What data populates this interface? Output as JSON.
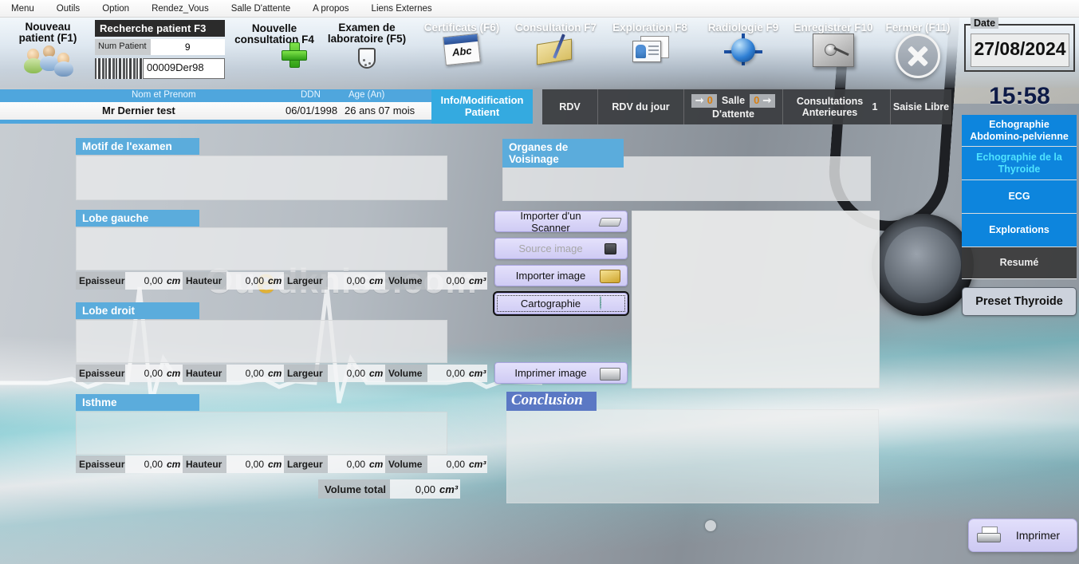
{
  "menubar": {
    "items": [
      {
        "label": "Menu",
        "name": "menu-item-menu"
      },
      {
        "label": "Outils",
        "name": "menu-item-outils"
      },
      {
        "label": "Option",
        "name": "menu-item-option"
      },
      {
        "label": "Rendez_Vous",
        "name": "menu-item-rendez-vous"
      },
      {
        "label": "Salle D'attente",
        "name": "menu-item-salle-dattente"
      },
      {
        "label": "A propos",
        "name": "menu-item-a-propos"
      },
      {
        "label": "Liens Externes",
        "name": "menu-item-liens-externes"
      }
    ]
  },
  "toolbar": {
    "new_patient": "Nouveau patient (F1)",
    "search_title": "Recherche patient F3",
    "num_patient_label": "Num Patient",
    "num_patient_value": "9",
    "barcode_value": "00009Der98",
    "new_consultation": "Nouvelle consultation F4",
    "lab_exam": "Examen de laboratoire (F5)",
    "certificats": "Certificats (F6)",
    "consultation": "Consultation F7",
    "exploration": "Exploration F8",
    "radiologie": "Radiologie F9",
    "enregistrer": "Enregistrer F10",
    "fermer": "Fermer (F11)"
  },
  "date_panel": {
    "legend": "Date",
    "date": "27/08/2024",
    "time": "15:58"
  },
  "patient": {
    "col_name": "Nom et Prenom",
    "col_ddn": "DDN",
    "col_age": "Age (An)",
    "name": "Mr Dernier test",
    "ddn": "06/01/1998",
    "age": "26 ans 07 mois",
    "info_button": "Info/Modification Patient"
  },
  "rdv_strip": {
    "rdv": "RDV",
    "rdv_du_jour": "RDV du jour",
    "waiting_in_count": "0",
    "salle_dattente": "Salle D'attente",
    "waiting_out_count": "0",
    "consultations_anterieures": "Consultations Anterieures",
    "consultations_count": "1",
    "saisie_libre": "Saisie Libre"
  },
  "form": {
    "motif_title": "Motif de l'examen",
    "motif_value": "",
    "lobe_gauche_title": "Lobe gauche",
    "lobe_gauche_value": "",
    "lobe_droit_title": "Lobe droit",
    "lobe_droit_value": "",
    "isthme_title": "Isthme",
    "isthme_value": "",
    "organes_title": "Organes de Voisinage",
    "organes_value": "",
    "conclusion_title": "Conclusion",
    "conclusion_value": "",
    "labels": {
      "epaisseur": "Epaisseur",
      "hauteur": "Hauteur",
      "largeur": "Largeur",
      "volume": "Volume",
      "volume_total": "Volume total",
      "cm": "cm",
      "cm3": "cm³"
    },
    "measurements": {
      "lobe_gauche": {
        "epaisseur": "0,00",
        "hauteur": "0,00",
        "largeur": "0,00",
        "volume": "0,00"
      },
      "lobe_droit": {
        "epaisseur": "0,00",
        "hauteur": "0,00",
        "largeur": "0,00",
        "volume": "0,00"
      },
      "isthme": {
        "epaisseur": "0,00",
        "hauteur": "0,00",
        "largeur": "0,00",
        "volume": "0,00"
      },
      "volume_total": "0,00"
    }
  },
  "image_buttons": {
    "importer_scanner": "Importer d'un Scanner",
    "source_image": "Source image",
    "importer_image": "Importer image",
    "cartographie": "Cartographie",
    "imprimer_image": "Imprimer image"
  },
  "sidebar": {
    "items": [
      {
        "label": "Echographie Abdomino-pelvienne",
        "name": "sidebar-item-echographie-abdomino-pelvienne",
        "state": "normal"
      },
      {
        "label": "Echographie de la Thyroide",
        "name": "sidebar-item-echographie-thyroide",
        "state": "active"
      },
      {
        "label": "ECG",
        "name": "sidebar-item-ecg",
        "state": "normal"
      },
      {
        "label": "Explorations",
        "name": "sidebar-item-explorations",
        "state": "normal"
      },
      {
        "label": "Resumé",
        "name": "sidebar-item-resume",
        "state": "dark"
      }
    ],
    "preset": "Preset Thyroide",
    "print": "Imprimer"
  },
  "watermark": {
    "pre": "Ou",
    "o": "e",
    "post": "dkniss.com",
    "full": "Ouedkniss.com"
  },
  "colors": {
    "accent_blue": "#5bacdc",
    "sidebar_blue": "#0d85dd",
    "sidebar_active_text": "#4fe3ff",
    "dark_strip": "#3a3c40",
    "button_violet": "#d6d2f7",
    "orange_count": "#d87f12",
    "conclusion_blue": "#5b78c4"
  }
}
